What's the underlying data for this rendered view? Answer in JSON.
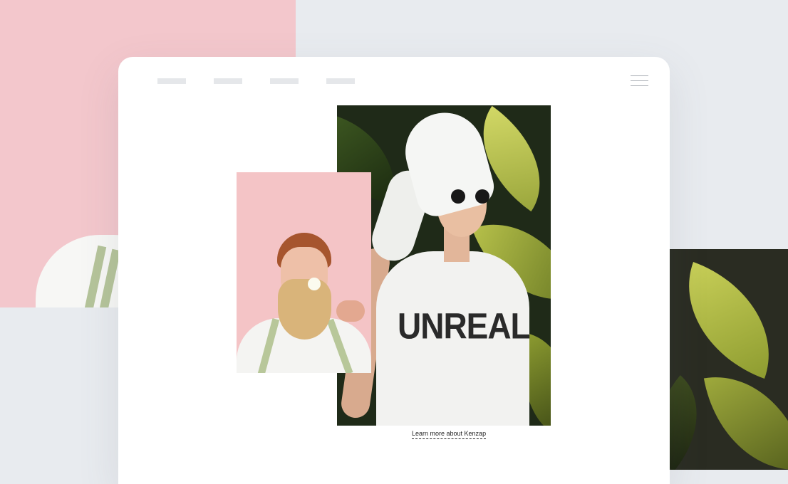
{
  "background": {
    "colors": {
      "page": "#e8ebef",
      "pink_panel": "#f3c7cc",
      "leaf_panel": "#2a2c22"
    }
  },
  "card": {
    "nav": {
      "items": [
        "",
        "",
        "",
        ""
      ]
    },
    "menu_icon": "hamburger-icon",
    "photos": {
      "woman": {
        "shirt_text": "UNREAL"
      },
      "man": {}
    },
    "link": {
      "label": "Learn more about Kenzap"
    }
  }
}
